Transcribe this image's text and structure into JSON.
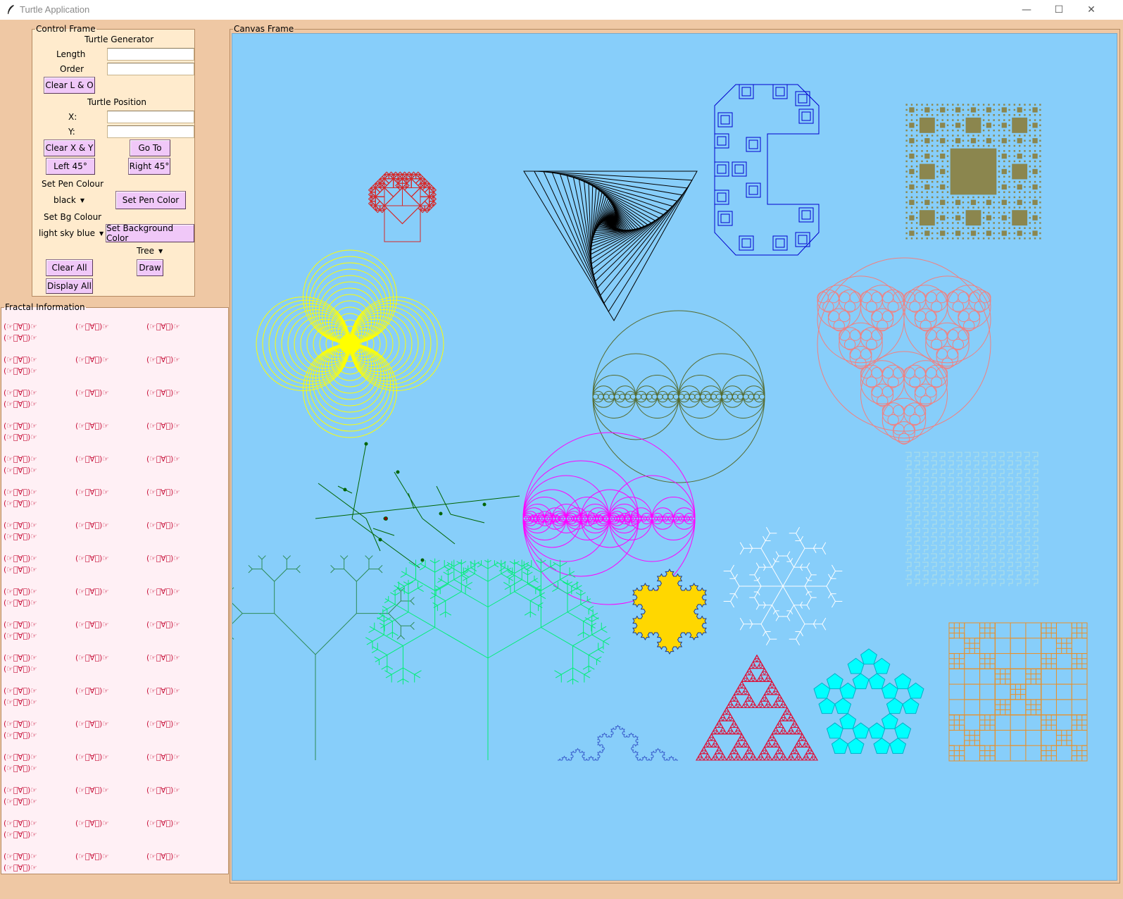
{
  "window": {
    "title": "Turtle Application",
    "minimize": "—",
    "maximize": "☐",
    "close": "✕"
  },
  "control": {
    "legend": "Control Frame",
    "turtle_generator": "Turtle Generator",
    "length_label": "Length",
    "length_value": "",
    "order_label": "Order",
    "order_value": "",
    "clear_lo": "Clear L & O",
    "turtle_position": "Turtle Position",
    "x_label": "X:",
    "x_value": "",
    "y_label": "Y:",
    "y_value": "",
    "clear_xy": "Clear X & Y",
    "go_to": "Go To",
    "left45": "Left 45°",
    "right45": "Right 45°",
    "set_pen_colour": "Set Pen Colour",
    "pen_colour_value": "black",
    "set_pen_color_btn": "Set Pen Color",
    "set_bg_colour": "Set Bg Colour",
    "bg_colour_value": "light sky blue",
    "set_bg_color_btn": "Set Background Color",
    "fractal_value": "Tree",
    "draw": "Draw",
    "clear_all": "Clear All",
    "display_all": "Display All"
  },
  "info": {
    "legend": "Fractal Information",
    "cell_text": "(☞ﾟ∀ﾟ)☞",
    "row_count": 17
  },
  "canvas": {
    "legend": "Canvas Frame",
    "background": "#87cefa",
    "fractal_colors": {
      "pythagoras_tree": "#d62828",
      "spiral_triangle": "#000000",
      "dragon_square": "#0000cd",
      "sierpinski_carpet": "#8b864e",
      "circle_flower": "#ffff00",
      "circles_line": "#556b2f",
      "apollonian": "#f08080",
      "branch": "#006400",
      "magenta_circles": "#ff00ff",
      "h_tree": "#2e8b57",
      "fern_tree": "#00ee76",
      "koch_filled": "#ffd700",
      "snowflake": "#ffffff",
      "cyan_maze": "#b0e0e6",
      "cross_square": "#e8902a",
      "koch_blue": "#3a5fcd",
      "sierpinski_triangle": "#dc143c",
      "pentaflake": "#00ffff"
    }
  }
}
